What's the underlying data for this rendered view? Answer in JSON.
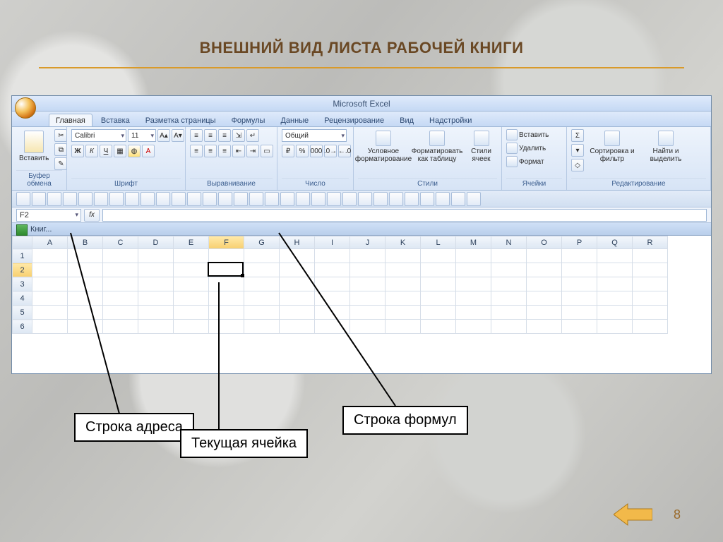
{
  "slide": {
    "title": "ВНЕШНИЙ ВИД ЛИСТА РАБОЧЕЙ КНИГИ",
    "pagenum": "8"
  },
  "app_title": "Microsoft Excel",
  "workbook_caption": "Книг...",
  "tabs": [
    "Главная",
    "Вставка",
    "Разметка страницы",
    "Формулы",
    "Данные",
    "Рецензирование",
    "Вид",
    "Надстройки"
  ],
  "ribbon_groups": {
    "clipboard": {
      "label": "Буфер обмена",
      "paste": "Вставить"
    },
    "font": {
      "label": "Шрифт",
      "name": "Calibri",
      "size": "11",
      "b": "Ж",
      "i": "К",
      "u": "Ч"
    },
    "align": {
      "label": "Выравнивание"
    },
    "number": {
      "label": "Число",
      "format": "Общий",
      "pct": "%",
      "thous": "000"
    },
    "styles": {
      "label": "Стили",
      "cond": "Условное форматирование",
      "table": "Форматировать как таблицу",
      "cell": "Стили ячеек"
    },
    "cells": {
      "label": "Ячейки",
      "ins": "Вставить",
      "del": "Удалить",
      "fmt": "Формат"
    },
    "edit": {
      "label": "Редактирование",
      "sort": "Сортировка и фильтр",
      "find": "Найти и выделить",
      "sum": "Σ"
    }
  },
  "namebox": "F2",
  "fx_label": "fx",
  "columns": [
    "A",
    "B",
    "C",
    "D",
    "E",
    "F",
    "G",
    "H",
    "I",
    "J",
    "K",
    "L",
    "M",
    "N",
    "O",
    "P",
    "Q",
    "R"
  ],
  "rows": [
    "1",
    "2",
    "3",
    "4",
    "5",
    "6"
  ],
  "active": {
    "col": "F",
    "row": "2"
  },
  "callouts": {
    "addr": "Строка адреса",
    "cell": "Текущая ячейка",
    "formula": "Строка формул"
  }
}
